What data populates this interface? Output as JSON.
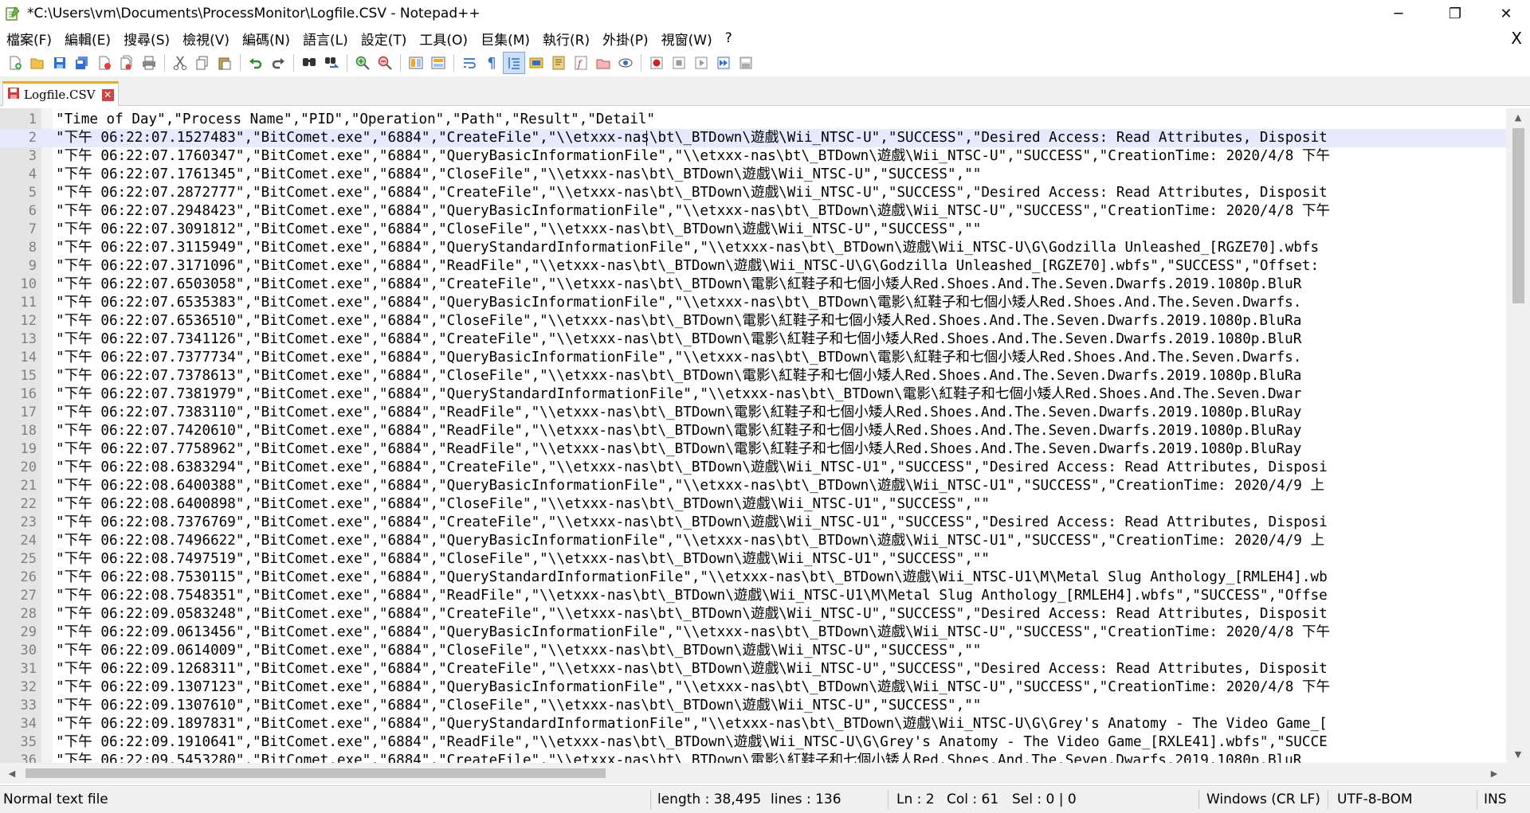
{
  "window": {
    "title": "*C:\\Users\\vm\\Documents\\ProcessMonitor\\Logfile.CSV - Notepad++",
    "minimize": "─",
    "restore": "❐",
    "close": "✕"
  },
  "menu": {
    "items": [
      "檔案(F)",
      "編輯(E)",
      "搜尋(S)",
      "檢視(V)",
      "編碼(N)",
      "語言(L)",
      "設定(T)",
      "工具(O)",
      "巨集(M)",
      "執行(R)",
      "外掛(P)",
      "視窗(W)",
      "?"
    ],
    "close": "X"
  },
  "toolbar": {
    "buttons": [
      "new-file-icon",
      "open-file-icon",
      "save-icon",
      "save-all-icon",
      "close-icon",
      "close-all-icon",
      "print-icon",
      "cut-icon",
      "copy-icon",
      "paste-icon",
      "undo-icon",
      "redo-icon",
      "find-icon",
      "replace-icon",
      "zoom-in-icon",
      "zoom-out-icon",
      "sync-vertical-icon",
      "sync-horizontal-icon",
      "word-wrap-icon",
      "show-all-characters-icon",
      "indent-guide-icon",
      "user-language-icon",
      "document-map-icon",
      "function-list-icon",
      "folder-workspace-icon",
      "monitoring-icon",
      "record-macro-icon",
      "stop-recording-icon",
      "playback-macro-icon",
      "run-macro-multiple-icon",
      "save-macro-icon"
    ],
    "colors": {
      "accent": "#f5a623",
      "record": "#d42020"
    }
  },
  "tab": {
    "label": "Logfile.CSV",
    "close": "✕"
  },
  "editor": {
    "current_line": 2,
    "lines": [
      {
        "n": "1",
        "text": "\"Time of Day\",\"Process Name\",\"PID\",\"Operation\",\"Path\",\"Result\",\"Detail\""
      },
      {
        "n": "2",
        "text": "\"下午 06:22:07.1527483\",\"BitComet.exe\",\"6884\",\"CreateFile\",\"\\\\etxxx-nas\\bt\\_BTDown\\遊戲\\Wii_NTSC-U\",\"SUCCESS\",\"Desired Access: Read Attributes, Disposit"
      },
      {
        "n": "3",
        "text": "\"下午 06:22:07.1760347\",\"BitComet.exe\",\"6884\",\"QueryBasicInformationFile\",\"\\\\etxxx-nas\\bt\\_BTDown\\遊戲\\Wii_NTSC-U\",\"SUCCESS\",\"CreationTime: 2020/4/8 下午"
      },
      {
        "n": "4",
        "text": "\"下午 06:22:07.1761345\",\"BitComet.exe\",\"6884\",\"CloseFile\",\"\\\\etxxx-nas\\bt\\_BTDown\\遊戲\\Wii_NTSC-U\",\"SUCCESS\",\"\""
      },
      {
        "n": "5",
        "text": "\"下午 06:22:07.2872777\",\"BitComet.exe\",\"6884\",\"CreateFile\",\"\\\\etxxx-nas\\bt\\_BTDown\\遊戲\\Wii_NTSC-U\",\"SUCCESS\",\"Desired Access: Read Attributes, Disposit"
      },
      {
        "n": "6",
        "text": "\"下午 06:22:07.2948423\",\"BitComet.exe\",\"6884\",\"QueryBasicInformationFile\",\"\\\\etxxx-nas\\bt\\_BTDown\\遊戲\\Wii_NTSC-U\",\"SUCCESS\",\"CreationTime: 2020/4/8 下午"
      },
      {
        "n": "7",
        "text": "\"下午 06:22:07.3091812\",\"BitComet.exe\",\"6884\",\"CloseFile\",\"\\\\etxxx-nas\\bt\\_BTDown\\遊戲\\Wii_NTSC-U\",\"SUCCESS\",\"\""
      },
      {
        "n": "8",
        "text": "\"下午 06:22:07.3115949\",\"BitComet.exe\",\"6884\",\"QueryStandardInformationFile\",\"\\\\etxxx-nas\\bt\\_BTDown\\遊戲\\Wii_NTSC-U\\G\\Godzilla Unleashed_[RGZE70].wbfs"
      },
      {
        "n": "9",
        "text": "\"下午 06:22:07.3171096\",\"BitComet.exe\",\"6884\",\"ReadFile\",\"\\\\etxxx-nas\\bt\\_BTDown\\遊戲\\Wii_NTSC-U\\G\\Godzilla Unleashed_[RGZE70].wbfs\",\"SUCCESS\",\"Offset:"
      },
      {
        "n": "10",
        "text": "\"下午 06:22:07.6503058\",\"BitComet.exe\",\"6884\",\"CreateFile\",\"\\\\etxxx-nas\\bt\\_BTDown\\電影\\紅鞋子和七個小矮人Red.Shoes.And.The.Seven.Dwarfs.2019.1080p.BluR"
      },
      {
        "n": "11",
        "text": "\"下午 06:22:07.6535383\",\"BitComet.exe\",\"6884\",\"QueryBasicInformationFile\",\"\\\\etxxx-nas\\bt\\_BTDown\\電影\\紅鞋子和七個小矮人Red.Shoes.And.The.Seven.Dwarfs."
      },
      {
        "n": "12",
        "text": "\"下午 06:22:07.6536510\",\"BitComet.exe\",\"6884\",\"CloseFile\",\"\\\\etxxx-nas\\bt\\_BTDown\\電影\\紅鞋子和七個小矮人Red.Shoes.And.The.Seven.Dwarfs.2019.1080p.BluRa"
      },
      {
        "n": "13",
        "text": "\"下午 06:22:07.7341126\",\"BitComet.exe\",\"6884\",\"CreateFile\",\"\\\\etxxx-nas\\bt\\_BTDown\\電影\\紅鞋子和七個小矮人Red.Shoes.And.The.Seven.Dwarfs.2019.1080p.BluR"
      },
      {
        "n": "14",
        "text": "\"下午 06:22:07.7377734\",\"BitComet.exe\",\"6884\",\"QueryBasicInformationFile\",\"\\\\etxxx-nas\\bt\\_BTDown\\電影\\紅鞋子和七個小矮人Red.Shoes.And.The.Seven.Dwarfs."
      },
      {
        "n": "15",
        "text": "\"下午 06:22:07.7378613\",\"BitComet.exe\",\"6884\",\"CloseFile\",\"\\\\etxxx-nas\\bt\\_BTDown\\電影\\紅鞋子和七個小矮人Red.Shoes.And.The.Seven.Dwarfs.2019.1080p.BluRa"
      },
      {
        "n": "16",
        "text": "\"下午 06:22:07.7381979\",\"BitComet.exe\",\"6884\",\"QueryStandardInformationFile\",\"\\\\etxxx-nas\\bt\\_BTDown\\電影\\紅鞋子和七個小矮人Red.Shoes.And.The.Seven.Dwar"
      },
      {
        "n": "17",
        "text": "\"下午 06:22:07.7383110\",\"BitComet.exe\",\"6884\",\"ReadFile\",\"\\\\etxxx-nas\\bt\\_BTDown\\電影\\紅鞋子和七個小矮人Red.Shoes.And.The.Seven.Dwarfs.2019.1080p.BluRay"
      },
      {
        "n": "18",
        "text": "\"下午 06:22:07.7420610\",\"BitComet.exe\",\"6884\",\"ReadFile\",\"\\\\etxxx-nas\\bt\\_BTDown\\電影\\紅鞋子和七個小矮人Red.Shoes.And.The.Seven.Dwarfs.2019.1080p.BluRay"
      },
      {
        "n": "19",
        "text": "\"下午 06:22:07.7758962\",\"BitComet.exe\",\"6884\",\"ReadFile\",\"\\\\etxxx-nas\\bt\\_BTDown\\電影\\紅鞋子和七個小矮人Red.Shoes.And.The.Seven.Dwarfs.2019.1080p.BluRay"
      },
      {
        "n": "20",
        "text": "\"下午 06:22:08.6383294\",\"BitComet.exe\",\"6884\",\"CreateFile\",\"\\\\etxxx-nas\\bt\\_BTDown\\遊戲\\Wii_NTSC-U1\",\"SUCCESS\",\"Desired Access: Read Attributes, Disposi"
      },
      {
        "n": "21",
        "text": "\"下午 06:22:08.6400388\",\"BitComet.exe\",\"6884\",\"QueryBasicInformationFile\",\"\\\\etxxx-nas\\bt\\_BTDown\\遊戲\\Wii_NTSC-U1\",\"SUCCESS\",\"CreationTime: 2020/4/9 上"
      },
      {
        "n": "22",
        "text": "\"下午 06:22:08.6400898\",\"BitComet.exe\",\"6884\",\"CloseFile\",\"\\\\etxxx-nas\\bt\\_BTDown\\遊戲\\Wii_NTSC-U1\",\"SUCCESS\",\"\""
      },
      {
        "n": "23",
        "text": "\"下午 06:22:08.7376769\",\"BitComet.exe\",\"6884\",\"CreateFile\",\"\\\\etxxx-nas\\bt\\_BTDown\\遊戲\\Wii_NTSC-U1\",\"SUCCESS\",\"Desired Access: Read Attributes, Disposi"
      },
      {
        "n": "24",
        "text": "\"下午 06:22:08.7496622\",\"BitComet.exe\",\"6884\",\"QueryBasicInformationFile\",\"\\\\etxxx-nas\\bt\\_BTDown\\遊戲\\Wii_NTSC-U1\",\"SUCCESS\",\"CreationTime: 2020/4/9 上"
      },
      {
        "n": "25",
        "text": "\"下午 06:22:08.7497519\",\"BitComet.exe\",\"6884\",\"CloseFile\",\"\\\\etxxx-nas\\bt\\_BTDown\\遊戲\\Wii_NTSC-U1\",\"SUCCESS\",\"\""
      },
      {
        "n": "26",
        "text": "\"下午 06:22:08.7530115\",\"BitComet.exe\",\"6884\",\"QueryStandardInformationFile\",\"\\\\etxxx-nas\\bt\\_BTDown\\遊戲\\Wii_NTSC-U1\\M\\Metal Slug Anthology_[RMLEH4].wb"
      },
      {
        "n": "27",
        "text": "\"下午 06:22:08.7548351\",\"BitComet.exe\",\"6884\",\"ReadFile\",\"\\\\etxxx-nas\\bt\\_BTDown\\遊戲\\Wii_NTSC-U1\\M\\Metal Slug Anthology_[RMLEH4].wbfs\",\"SUCCESS\",\"Offse"
      },
      {
        "n": "28",
        "text": "\"下午 06:22:09.0583248\",\"BitComet.exe\",\"6884\",\"CreateFile\",\"\\\\etxxx-nas\\bt\\_BTDown\\遊戲\\Wii_NTSC-U\",\"SUCCESS\",\"Desired Access: Read Attributes, Disposit"
      },
      {
        "n": "29",
        "text": "\"下午 06:22:09.0613456\",\"BitComet.exe\",\"6884\",\"QueryBasicInformationFile\",\"\\\\etxxx-nas\\bt\\_BTDown\\遊戲\\Wii_NTSC-U\",\"SUCCESS\",\"CreationTime: 2020/4/8 下午"
      },
      {
        "n": "30",
        "text": "\"下午 06:22:09.0614009\",\"BitComet.exe\",\"6884\",\"CloseFile\",\"\\\\etxxx-nas\\bt\\_BTDown\\遊戲\\Wii_NTSC-U\",\"SUCCESS\",\"\""
      },
      {
        "n": "31",
        "text": "\"下午 06:22:09.1268311\",\"BitComet.exe\",\"6884\",\"CreateFile\",\"\\\\etxxx-nas\\bt\\_BTDown\\遊戲\\Wii_NTSC-U\",\"SUCCESS\",\"Desired Access: Read Attributes, Disposit"
      },
      {
        "n": "32",
        "text": "\"下午 06:22:09.1307123\",\"BitComet.exe\",\"6884\",\"QueryBasicInformationFile\",\"\\\\etxxx-nas\\bt\\_BTDown\\遊戲\\Wii_NTSC-U\",\"SUCCESS\",\"CreationTime: 2020/4/8 下午"
      },
      {
        "n": "33",
        "text": "\"下午 06:22:09.1307610\",\"BitComet.exe\",\"6884\",\"CloseFile\",\"\\\\etxxx-nas\\bt\\_BTDown\\遊戲\\Wii_NTSC-U\",\"SUCCESS\",\"\""
      },
      {
        "n": "34",
        "text": "\"下午 06:22:09.1897831\",\"BitComet.exe\",\"6884\",\"QueryStandardInformationFile\",\"\\\\etxxx-nas\\bt\\_BTDown\\遊戲\\Wii_NTSC-U\\G\\Grey's Anatomy - The Video Game_["
      },
      {
        "n": "35",
        "text": "\"下午 06:22:09.1910641\",\"BitComet.exe\",\"6884\",\"ReadFile\",\"\\\\etxxx-nas\\bt\\_BTDown\\遊戲\\Wii_NTSC-U\\G\\Grey's Anatomy - The Video Game_[RXLE41].wbfs\",\"SUCCE"
      },
      {
        "n": "36",
        "text": "\"下午 06:22:09.5453280\",\"BitComet.exe\",\"6884\",\"CreateFile\",\"\\\\etxxx-nas\\bt\\_BTDown\\電影\\紅鞋子和七個小矮人Red.Shoes.And.The.Seven.Dwarfs.2019.1080p.BluR"
      }
    ]
  },
  "status": {
    "file_type": "Normal text file",
    "length": "length : 38,495",
    "lines": "lines : 136",
    "ln": "Ln : 2",
    "col": "Col : 61",
    "sel": "Sel : 0 | 0",
    "eol": "Windows (CR LF)",
    "encoding": "UTF-8-BOM",
    "mode": "INS"
  }
}
